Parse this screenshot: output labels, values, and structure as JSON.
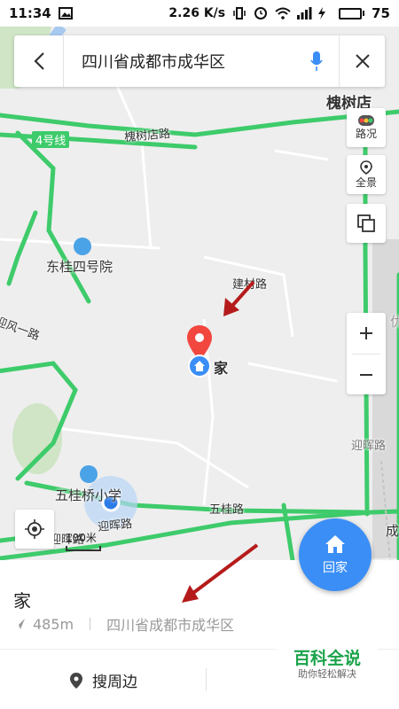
{
  "status_bar": {
    "time": "11:34",
    "speed": "2.26 K/s",
    "battery": "75",
    "battery_level": 0.75
  },
  "search": {
    "query": "四川省成都市成华区"
  },
  "map": {
    "labels": {
      "huaishudian": "槐树店",
      "huaishudian_road": "槐树店路",
      "line4": "4号线",
      "dongui": "东桂四号院",
      "jiancai_road": "建材路",
      "yingfeng": "迎风一路",
      "home_marker": "家",
      "yinghui_road1": "迎晖路",
      "yinghui_road2": "迎晖路",
      "yinghui_road3": "迎晖路",
      "wugui_road": "五桂路",
      "wuguiqiao": "五桂桥小学",
      "cheng": "成",
      "edge_text": "优"
    },
    "controls": {
      "traffic": "路况",
      "panorama": "全景"
    },
    "scale": "100米",
    "go_home": "回家"
  },
  "sheet": {
    "title": "家",
    "distance": "485m",
    "address": "四川省成都市成华区",
    "nearby": "搜周边"
  },
  "watermark": {
    "line1": "百科全说",
    "line2": "助你轻松解决"
  },
  "colors": {
    "road": "#3ecb6b",
    "accent": "#3a8ef6",
    "pin": "#f2473f",
    "arrow": "#b51b1b"
  }
}
